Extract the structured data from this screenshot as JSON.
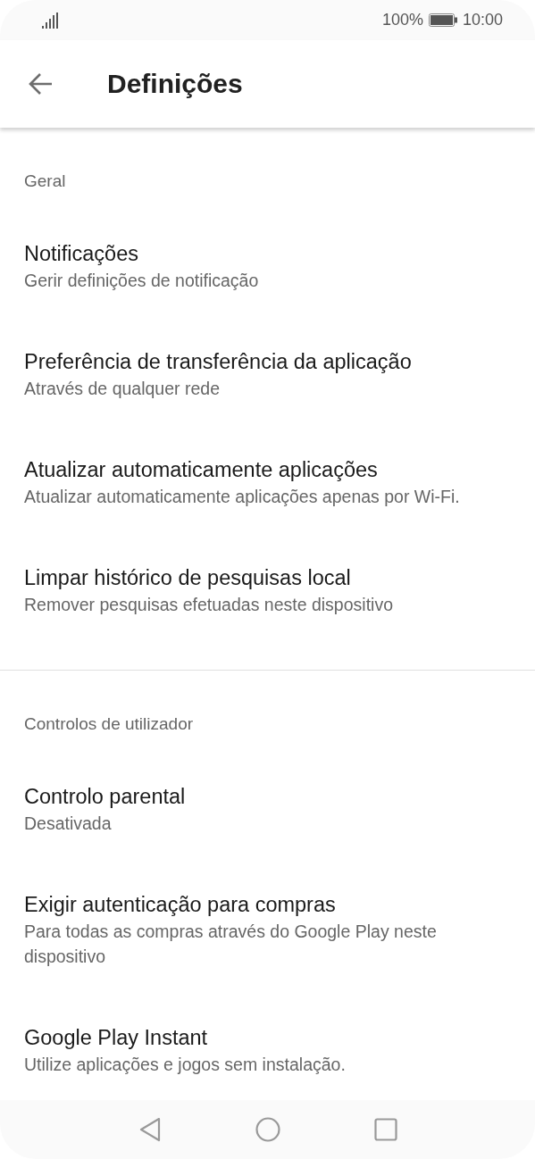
{
  "status_bar": {
    "battery": "100%",
    "time": "10:00"
  },
  "app_bar": {
    "title": "Definições"
  },
  "sections": [
    {
      "header": "Geral",
      "items": [
        {
          "title": "Notificações",
          "subtitle": "Gerir definições de notificação"
        },
        {
          "title": "Preferência de transferência da aplicação",
          "subtitle": "Através de qualquer rede"
        },
        {
          "title": "Atualizar automaticamente aplicações",
          "subtitle": "Atualizar automaticamente aplicações apenas por Wi-Fi."
        },
        {
          "title": "Limpar histórico de pesquisas local",
          "subtitle": "Remover pesquisas efetuadas neste dispositivo"
        }
      ]
    },
    {
      "header": "Controlos de utilizador",
      "items": [
        {
          "title": "Controlo parental",
          "subtitle": "Desativada"
        },
        {
          "title": "Exigir autenticação para compras",
          "subtitle": "Para todas as compras através do Google Play neste dispositivo"
        },
        {
          "title": "Google Play Instant",
          "subtitle": "Utilize aplicações e jogos sem instalação."
        }
      ]
    }
  ]
}
